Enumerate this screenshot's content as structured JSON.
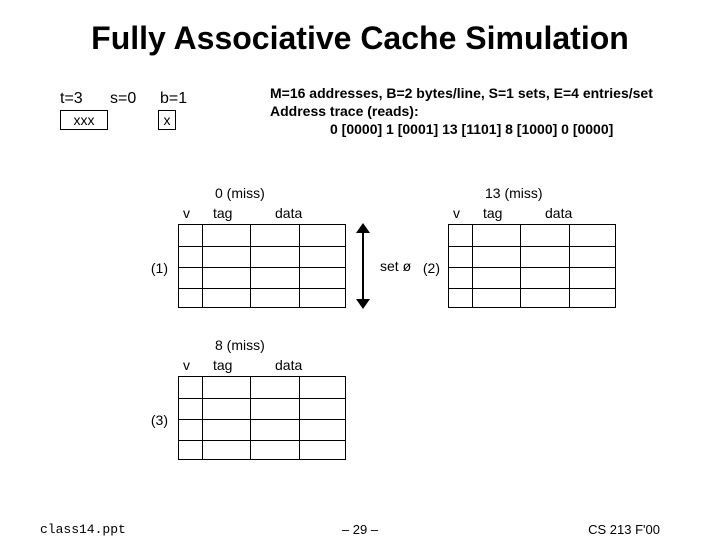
{
  "title": "Fully Associative Cache Simulation",
  "params": {
    "t_label": "t=3",
    "s_label": "s=0",
    "b_label": "b=1",
    "t_bits": "xxx",
    "b_bits": "x"
  },
  "desc": {
    "line1": "M=16 addresses, B=2 bytes/line, S=1 sets, E=4 entries/set",
    "line2": "Address trace (reads):",
    "trace": "0 [0000] 1 [0001] 13 [1101] 8 [1000] 0 [0000]"
  },
  "headers": {
    "v": "v",
    "tag": "tag",
    "data": "data"
  },
  "set_label": "set ø",
  "steps": {
    "s1": {
      "num": "(1)",
      "miss": "0 (miss)"
    },
    "s2": {
      "num": "(2)",
      "miss": "13 (miss)"
    },
    "s3": {
      "num": "(3)",
      "miss": "8 (miss)"
    }
  },
  "footer": {
    "file": "class14.ppt",
    "page": "– 29 –",
    "course": "CS 213 F'00"
  }
}
